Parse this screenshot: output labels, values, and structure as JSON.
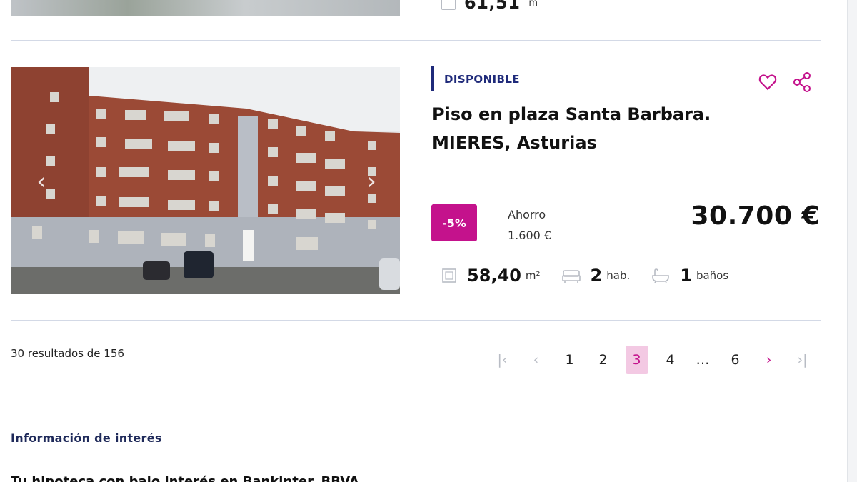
{
  "top_partial": {
    "area_value": "61,51",
    "area_unit": "m"
  },
  "listing": {
    "status": "DISPONIBLE",
    "title_line1": "Piso en plaza Santa Barbara.",
    "title_line2": "MIERES, Asturias",
    "discount": "-5%",
    "saving_label": "Ahorro",
    "saving_amount": "1.600 €",
    "price": "30.700 €",
    "specs": {
      "area": "58,40",
      "area_unit": "m²",
      "rooms": "2",
      "rooms_unit": "hab.",
      "baths": "1",
      "baths_unit": "baños"
    },
    "icons": {
      "favorite": "heart-icon",
      "share": "share-icon",
      "prev": "chevron-left-icon",
      "next": "chevron-right-icon"
    },
    "arrow_prev": "‹",
    "arrow_next": "›"
  },
  "results": {
    "count_text": "30 resultados de 156"
  },
  "pagination": {
    "first": "|‹",
    "prev": "‹",
    "pages": [
      "1",
      "2",
      "3",
      "4"
    ],
    "current": "3",
    "ellipsis": "…",
    "last_page": "6",
    "next": "›",
    "last": "›|"
  },
  "info": {
    "heading": "Información de interés",
    "cut_text": "Tu hipoteca con bajo interés en Bankinter. BBVA"
  },
  "colors": {
    "accent": "#c4128c",
    "navy": "#1f2a7a",
    "divider": "#d3d9e6"
  }
}
